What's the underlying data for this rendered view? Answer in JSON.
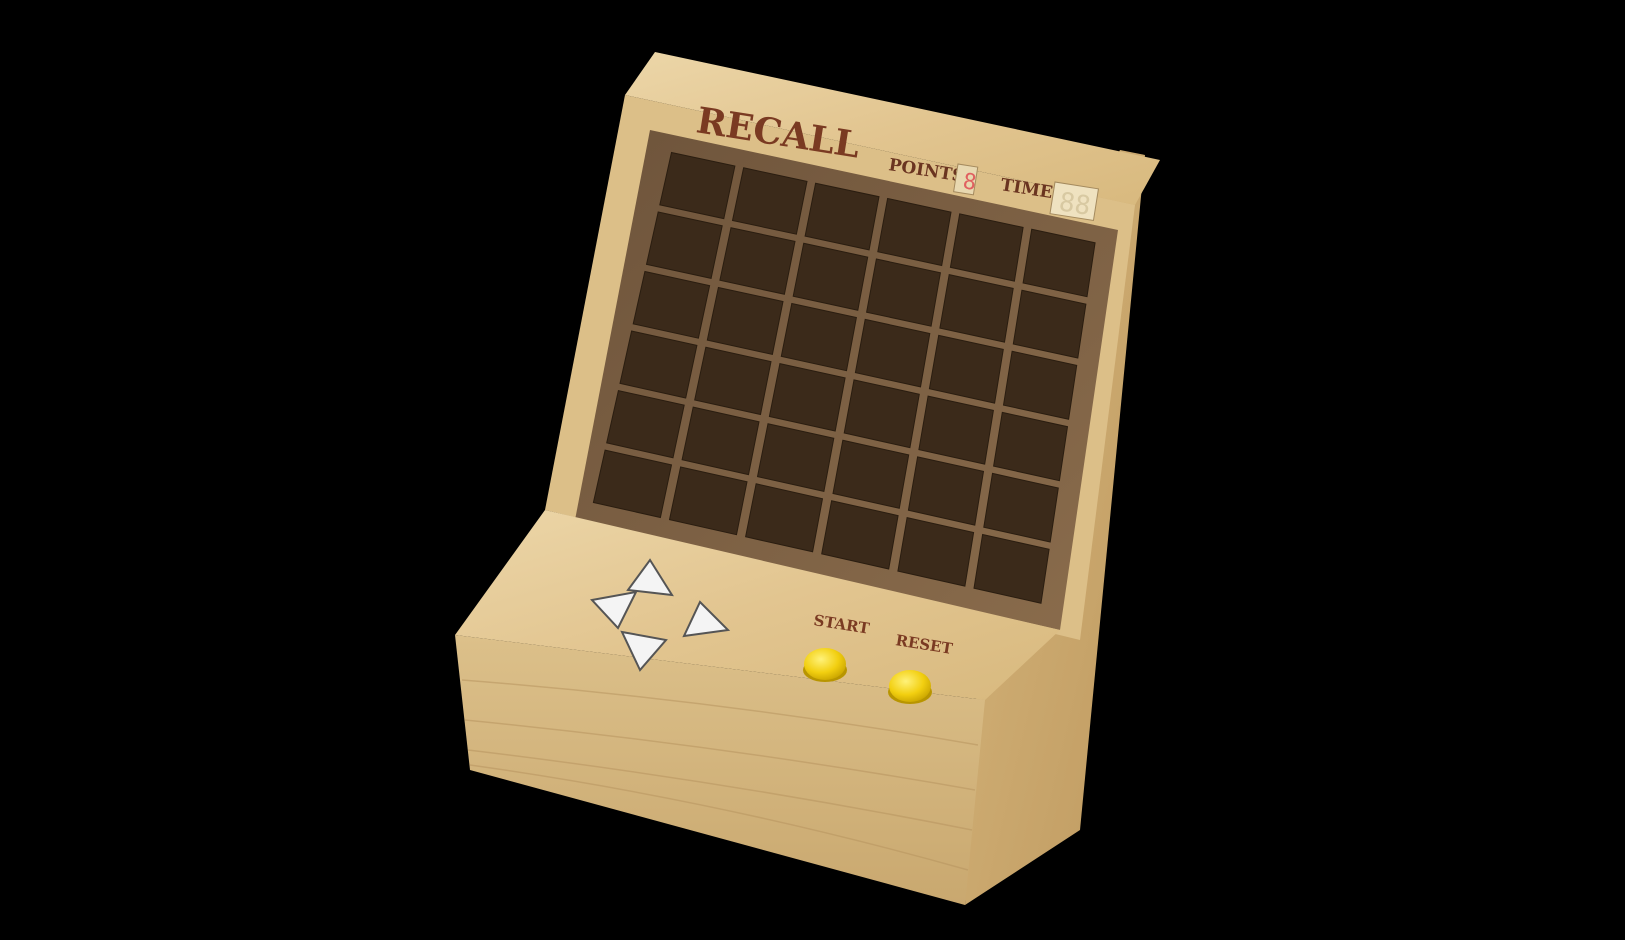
{
  "machine": {
    "title": "RECALL",
    "points_label": "POINTS",
    "points_value": "8",
    "time_label": "TIME",
    "time_value": "88",
    "start_label": "START",
    "reset_label": "RESET"
  },
  "grid": {
    "rows": 6,
    "cols": 6
  },
  "dpad": [
    "up",
    "left",
    "right",
    "down"
  ],
  "colors": {
    "background": "#000000",
    "wood_light": "#e6cc9c",
    "wood_mid": "#d3b47d",
    "wood_dark": "#b8945e",
    "screen": "#7a5f43",
    "cell": "#3b2a1a",
    "title_ink": "#7a3a22",
    "button_yellow": "#f2cf10"
  },
  "icons": {
    "dpad_up": "triangle-up-icon",
    "dpad_left": "triangle-left-icon",
    "dpad_right": "triangle-right-icon",
    "dpad_down": "triangle-down-icon"
  }
}
